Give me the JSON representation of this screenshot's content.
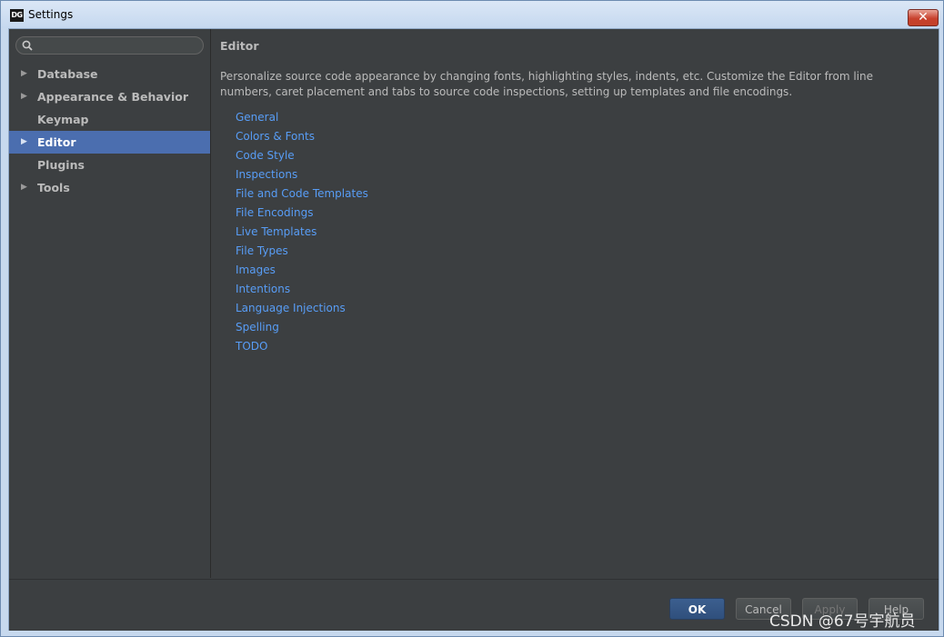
{
  "window": {
    "app_icon_text": "DG",
    "title": "Settings",
    "close_glyph": "✕"
  },
  "search": {
    "placeholder": "",
    "value": ""
  },
  "sidebar": {
    "items": [
      {
        "label": "Database",
        "expandable": true,
        "selected": false
      },
      {
        "label": "Appearance & Behavior",
        "expandable": true,
        "selected": false
      },
      {
        "label": "Keymap",
        "expandable": false,
        "selected": false
      },
      {
        "label": "Editor",
        "expandable": true,
        "selected": true
      },
      {
        "label": "Plugins",
        "expandable": false,
        "selected": false
      },
      {
        "label": "Tools",
        "expandable": true,
        "selected": false
      }
    ],
    "arrow_glyph": "▶"
  },
  "main": {
    "title": "Editor",
    "description": "Personalize source code appearance by changing fonts, highlighting styles, indents, etc. Customize the Editor from line numbers, caret placement and tabs to source code inspections, setting up templates and file encodings.",
    "links": [
      "General",
      "Colors & Fonts",
      "Code Style",
      "Inspections",
      "File and Code Templates",
      "File Encodings",
      "Live Templates",
      "File Types",
      "Images",
      "Intentions",
      "Language Injections",
      "Spelling",
      "TODO"
    ]
  },
  "buttons": {
    "ok": "OK",
    "cancel": "Cancel",
    "apply": "Apply",
    "help": "Help"
  },
  "watermark": "CSDN @67号宇航员",
  "colors": {
    "background": "#3c3f41",
    "selection": "#4b6eaf",
    "link": "#589df6",
    "text": "#bbbbbb"
  }
}
